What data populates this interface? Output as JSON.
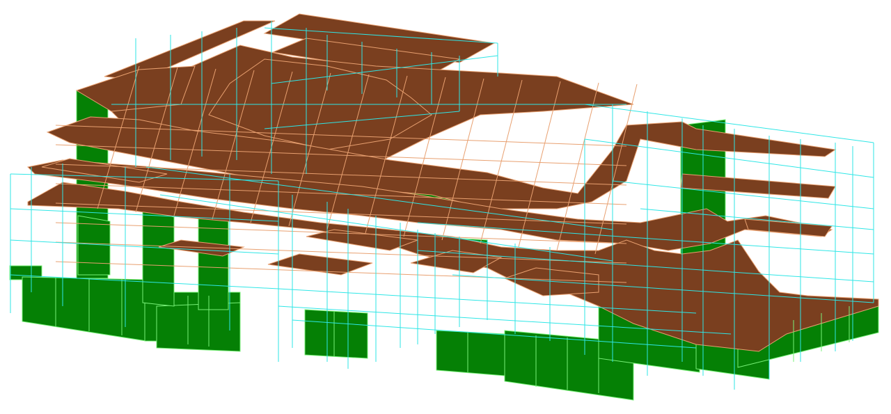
{
  "colors": {
    "background": "#ffffff",
    "slab_fill": "#7a3f1f",
    "slab_mesh": "#e8a070",
    "wall_fill": "#058005",
    "wall_mesh": "#78f078",
    "frame_line": "#2ee6e6"
  },
  "icons": {
    "viewport": "structural-model-3d"
  }
}
